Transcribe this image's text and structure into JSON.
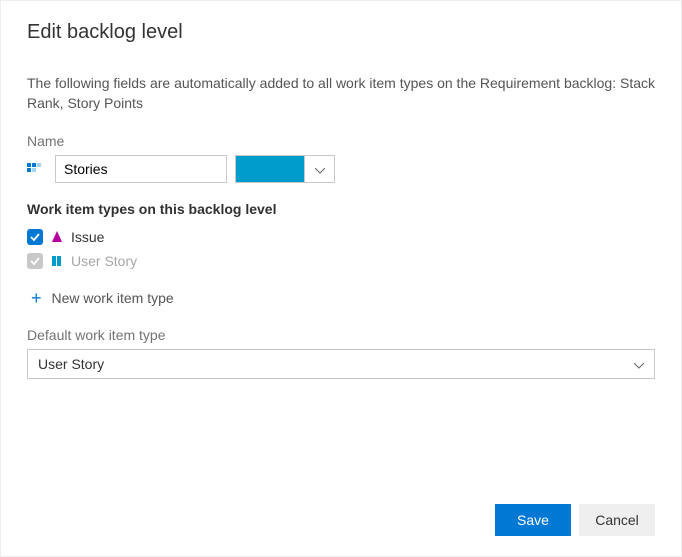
{
  "title": "Edit backlog level",
  "description": "The following fields are automatically added to all work item types on the Requirement backlog: Stack Rank, Story Points",
  "name_field": {
    "label": "Name",
    "value": "Stories",
    "color": "#009ccc"
  },
  "wit_section": {
    "label": "Work item types on this backlog level",
    "items": [
      {
        "label": "Issue",
        "checked": true,
        "disabled": false,
        "icon": "issue-icon"
      },
      {
        "label": "User Story",
        "checked": true,
        "disabled": true,
        "icon": "user-story-icon"
      }
    ],
    "new_label": "New work item type"
  },
  "default_wit": {
    "label": "Default work item type",
    "value": "User Story"
  },
  "footer": {
    "save_label": "Save",
    "cancel_label": "Cancel"
  }
}
